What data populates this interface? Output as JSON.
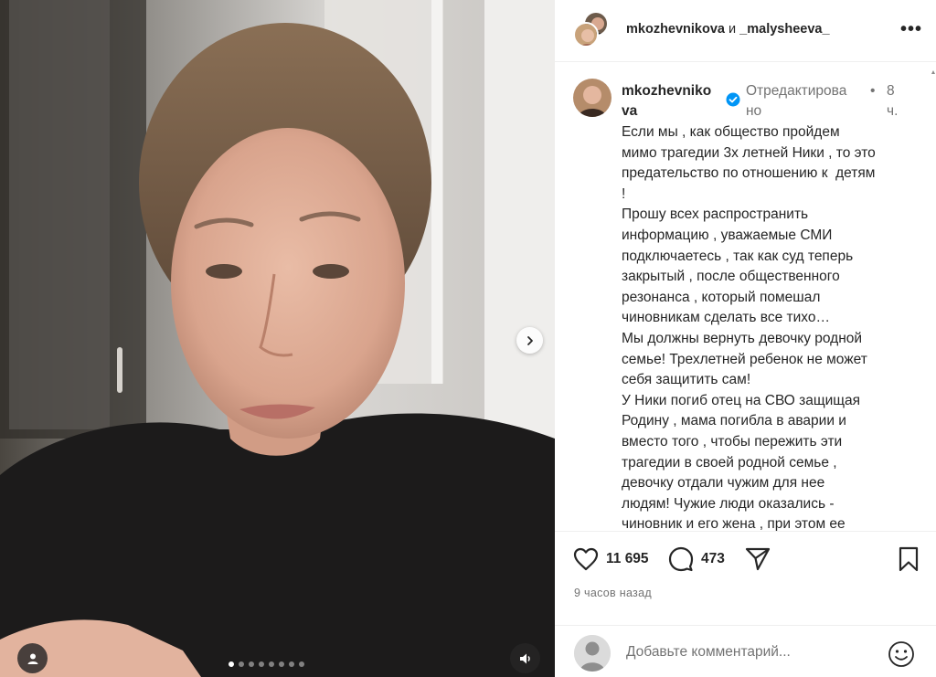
{
  "header": {
    "user1": "mkozhevnikova",
    "conj": " и ",
    "user2": "_malysheeva_",
    "more_label": "•••"
  },
  "post": {
    "author_line1": "mkozhevniko",
    "author_line2": "va",
    "edited_line1": "Отредактирова",
    "edited_line2": "но",
    "sep": "•",
    "time_line1": "8",
    "time_line2": "ч.",
    "caption": "Если мы , как общество пройдем\nмимо трагедии 3х летней Ники , то это\nпредательство по отношению к  детям\n!\nПрошу всех распространить\nинформацию , уважаемые СМИ\nподключаетесь , так как суд теперь\nзакрытый , после общественного\nрезонанса , который помешал\nчиновникам сделать все тихо…\nМы должны вернуть девочку родной\nсемье! Трехлетней ребенок не может\nсебя защитить сам!\nУ Ники погиб отец на СВО защищая\nРодину , мама погибла в аварии и\nвместо того , чтобы пережить эти\nтрагедии в своей родной семье ,\nдевочку отдали чужим для нее\nлюдям! Чужие люди оказались -\nчиновник и его жена , при этом ее"
  },
  "actions": {
    "likes": "11 695",
    "comments": "473"
  },
  "posted_ago": "9 часов назад",
  "comment_box": {
    "placeholder": "Добавьте комментарий..."
  },
  "carousel": {
    "slides": 8,
    "current_index": 0
  },
  "icons": {
    "like": "heart-icon",
    "comment": "comment-icon",
    "share": "send-icon",
    "save": "bookmark-icon",
    "verified": "verified-badge-icon",
    "next": "chevron-right-icon",
    "user_tag": "user-tag-icon",
    "sound": "speaker-icon",
    "emoji": "emoji-icon"
  },
  "colors": {
    "verified": "#0095f6",
    "secondary_text": "#737373",
    "primary_text": "#262626"
  }
}
